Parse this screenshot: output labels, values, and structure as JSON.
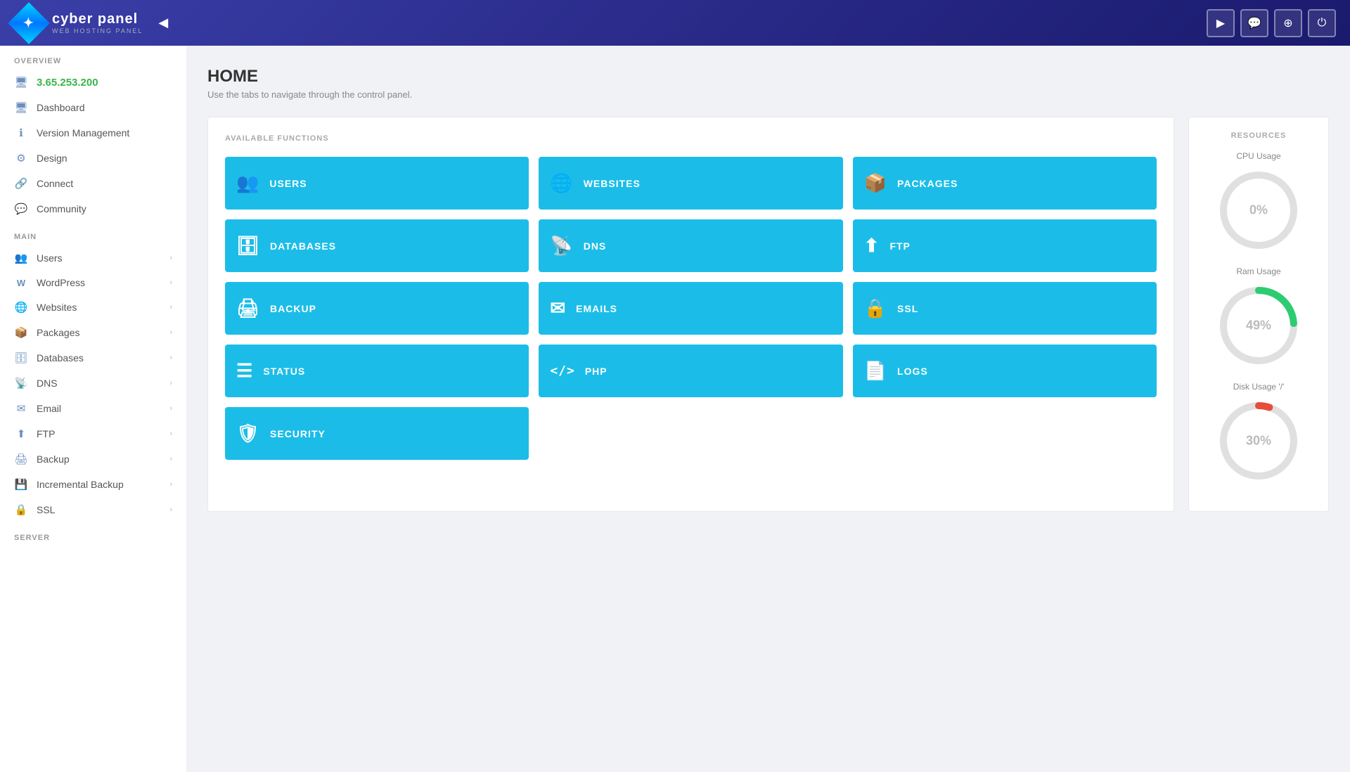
{
  "topnav": {
    "logo_title": "cyber panel",
    "logo_sub": "WEB HOSTING PANEL",
    "collapse_icon": "◀",
    "icons": [
      {
        "name": "youtube-icon",
        "symbol": "▶",
        "label": "YouTube"
      },
      {
        "name": "chat-icon",
        "symbol": "💬",
        "label": "Chat"
      },
      {
        "name": "support-icon",
        "symbol": "⊕",
        "label": "Support"
      },
      {
        "name": "power-icon",
        "symbol": "⏻",
        "label": "Power"
      }
    ]
  },
  "sidebar": {
    "overview_label": "OVERVIEW",
    "ip_address": "3.65.253.200",
    "overview_items": [
      {
        "label": "Dashboard",
        "icon": "🖥"
      },
      {
        "label": "Version Management",
        "icon": "ℹ"
      },
      {
        "label": "Design",
        "icon": "⚙"
      },
      {
        "label": "Connect",
        "icon": "🔗"
      },
      {
        "label": "Community",
        "icon": "💬"
      }
    ],
    "main_label": "MAIN",
    "main_items": [
      {
        "label": "Users",
        "icon": "👥",
        "has_arrow": true
      },
      {
        "label": "WordPress",
        "icon": "W",
        "has_arrow": true
      },
      {
        "label": "Websites",
        "icon": "🌐",
        "has_arrow": true
      },
      {
        "label": "Packages",
        "icon": "📦",
        "has_arrow": true
      },
      {
        "label": "Databases",
        "icon": "🗄",
        "has_arrow": true
      },
      {
        "label": "DNS",
        "icon": "📡",
        "has_arrow": true
      },
      {
        "label": "Email",
        "icon": "✈",
        "has_arrow": true
      },
      {
        "label": "FTP",
        "icon": "⬆",
        "has_arrow": true
      },
      {
        "label": "Backup",
        "icon": "🖨",
        "has_arrow": true
      },
      {
        "label": "Incremental Backup",
        "icon": "💾",
        "has_arrow": true
      },
      {
        "label": "SSL",
        "icon": "🔒",
        "has_arrow": true
      }
    ],
    "server_label": "SERVER"
  },
  "home": {
    "title": "HOME",
    "subtitle": "Use the tabs to navigate through the control panel."
  },
  "functions": {
    "section_title": "AVAILABLE FUNCTIONS",
    "items": [
      {
        "label": "USERS",
        "icon": "👥"
      },
      {
        "label": "WEBSITES",
        "icon": "🌐"
      },
      {
        "label": "PACKAGES",
        "icon": "📦"
      },
      {
        "label": "DATABASES",
        "icon": "🗄"
      },
      {
        "label": "DNS",
        "icon": "📡"
      },
      {
        "label": "FTP",
        "icon": "⬆"
      },
      {
        "label": "BACKUP",
        "icon": "🖨"
      },
      {
        "label": "EMAILS",
        "icon": "✉"
      },
      {
        "label": "SSL",
        "icon": "🔒"
      },
      {
        "label": "STATUS",
        "icon": "☰"
      },
      {
        "label": "PHP",
        "icon": "⟨/⟩"
      },
      {
        "label": "LOGS",
        "icon": "📄"
      },
      {
        "label": "SECURITY",
        "icon": "🛡"
      }
    ]
  },
  "resources": {
    "title": "RESOURCES",
    "cpu": {
      "label": "CPU Usage",
      "value": 0,
      "display": "0%",
      "color": "#e0e0e0",
      "track_color": "#e0e0e0"
    },
    "ram": {
      "label": "Ram Usage",
      "value": 49,
      "display": "49%",
      "color": "#2ecc71",
      "track_color": "#e0e0e0"
    },
    "disk": {
      "label": "Disk Usage '/'",
      "value": 30,
      "display": "30%",
      "color": "#e74c3c",
      "track_color": "#e0e0e0"
    }
  }
}
